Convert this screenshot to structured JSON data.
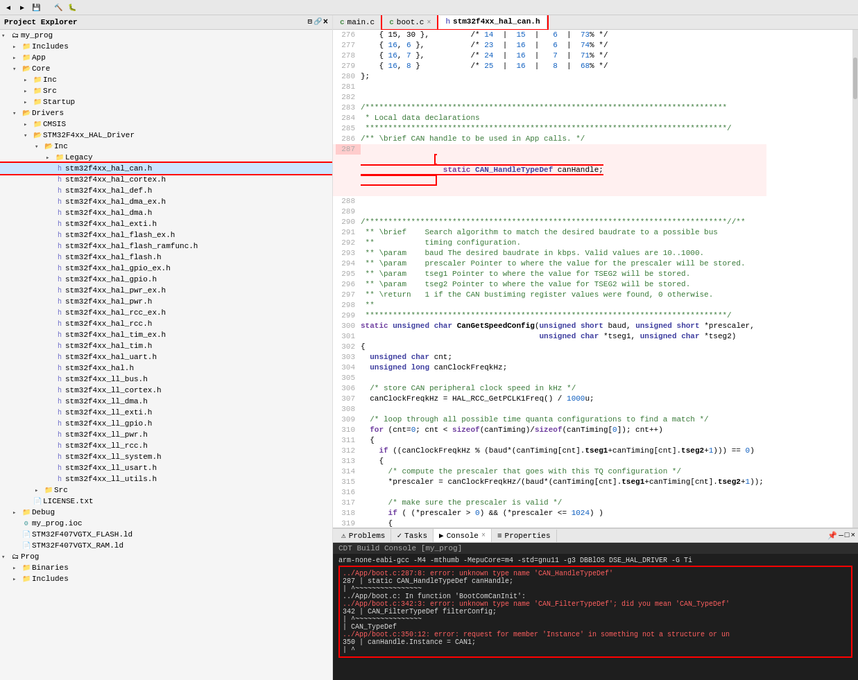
{
  "toolbar": {
    "title": "Project Explorer"
  },
  "sidebar": {
    "header": "Project Explorer",
    "close_icon": "×",
    "tree": [
      {
        "id": "my_prog",
        "label": "my_prog",
        "level": 0,
        "type": "project",
        "expanded": true,
        "arrow": "▾"
      },
      {
        "id": "includes_root",
        "label": "Includes",
        "level": 1,
        "type": "folder",
        "expanded": false,
        "arrow": "▸"
      },
      {
        "id": "app",
        "label": "App",
        "level": 1,
        "type": "folder",
        "expanded": false,
        "arrow": "▸"
      },
      {
        "id": "core",
        "label": "Core",
        "level": 1,
        "type": "folder",
        "expanded": true,
        "arrow": "▾"
      },
      {
        "id": "inc",
        "label": "Inc",
        "level": 2,
        "type": "folder",
        "expanded": false,
        "arrow": "▸"
      },
      {
        "id": "src",
        "label": "Src",
        "level": 2,
        "type": "folder",
        "expanded": false,
        "arrow": "▸"
      },
      {
        "id": "startup",
        "label": "Startup",
        "level": 2,
        "type": "folder",
        "expanded": false,
        "arrow": "▸"
      },
      {
        "id": "drivers",
        "label": "Drivers",
        "level": 1,
        "type": "folder",
        "expanded": true,
        "arrow": "▾"
      },
      {
        "id": "cmsis",
        "label": "CMSIS",
        "level": 2,
        "type": "folder",
        "expanded": false,
        "arrow": "▸"
      },
      {
        "id": "stm32f4xx_hal_driver",
        "label": "STM32F4xx_HAL_Driver",
        "level": 2,
        "type": "folder",
        "expanded": true,
        "arrow": "▾"
      },
      {
        "id": "inc2",
        "label": "Inc",
        "level": 3,
        "type": "folder",
        "expanded": true,
        "arrow": "▾"
      },
      {
        "id": "legacy",
        "label": "Legacy",
        "level": 4,
        "type": "folder",
        "expanded": false,
        "arrow": "▸"
      },
      {
        "id": "stm32f4xx_hal_can_h",
        "label": "stm32f4xx_hal_can.h",
        "level": 4,
        "type": "file_h",
        "expanded": false,
        "arrow": "",
        "selected": true,
        "highlighted": true
      },
      {
        "id": "stm32f4xx_hal_cortex_h",
        "label": "stm32f4xx_hal_cortex.h",
        "level": 4,
        "type": "file_h",
        "arrow": ""
      },
      {
        "id": "stm32f4xx_hal_def_h",
        "label": "stm32f4xx_hal_def.h",
        "level": 4,
        "type": "file_h",
        "arrow": ""
      },
      {
        "id": "stm32f4xx_hal_dma_ex_h",
        "label": "stm32f4xx_hal_dma_ex.h",
        "level": 4,
        "type": "file_h",
        "arrow": ""
      },
      {
        "id": "stm32f4xx_hal_dma_h",
        "label": "stm32f4xx_hal_dma.h",
        "level": 4,
        "type": "file_h",
        "arrow": ""
      },
      {
        "id": "stm32f4xx_hal_exti_h",
        "label": "stm32f4xx_hal_exti.h",
        "level": 4,
        "type": "file_h",
        "arrow": ""
      },
      {
        "id": "stm32f4xx_hal_flash_ex_h",
        "label": "stm32f4xx_hal_flash_ex.h",
        "level": 4,
        "type": "file_h",
        "arrow": ""
      },
      {
        "id": "stm32f4xx_hal_flash_ramfunc_h",
        "label": "stm32f4xx_hal_flash_ramfunc.h",
        "level": 4,
        "type": "file_h",
        "arrow": ""
      },
      {
        "id": "stm32f4xx_hal_flash_h",
        "label": "stm32f4xx_hal_flash.h",
        "level": 4,
        "type": "file_h",
        "arrow": ""
      },
      {
        "id": "stm32f4xx_hal_gpio_ex_h",
        "label": "stm32f4xx_hal_gpio_ex.h",
        "level": 4,
        "type": "file_h",
        "arrow": ""
      },
      {
        "id": "stm32f4xx_hal_gpio_h",
        "label": "stm32f4xx_hal_gpio.h",
        "level": 4,
        "type": "file_h",
        "arrow": ""
      },
      {
        "id": "stm32f4xx_hal_pwr_ex_h",
        "label": "stm32f4xx_hal_pwr_ex.h",
        "level": 4,
        "type": "file_h",
        "arrow": ""
      },
      {
        "id": "stm32f4xx_hal_pwr_h",
        "label": "stm32f4xx_hal_pwr.h",
        "level": 4,
        "type": "file_h",
        "arrow": ""
      },
      {
        "id": "stm32f4xx_hal_rcc_ex_h",
        "label": "stm32f4xx_hal_rcc_ex.h",
        "level": 4,
        "type": "file_h",
        "arrow": ""
      },
      {
        "id": "stm32f4xx_hal_rcc_h",
        "label": "stm32f4xx_hal_rcc.h",
        "level": 4,
        "type": "file_h",
        "arrow": ""
      },
      {
        "id": "stm32f4xx_hal_tim_ex_h",
        "label": "stm32f4xx_hal_tim_ex.h",
        "level": 4,
        "type": "file_h",
        "arrow": ""
      },
      {
        "id": "stm32f4xx_hal_tim_h",
        "label": "stm32f4xx_hal_tim.h",
        "level": 4,
        "type": "file_h",
        "arrow": ""
      },
      {
        "id": "stm32f4xx_hal_uart_h",
        "label": "stm32f4xx_hal_uart.h",
        "level": 4,
        "type": "file_h",
        "arrow": ""
      },
      {
        "id": "stm32f4xx_hal_h",
        "label": "stm32f4xx_hal.h",
        "level": 4,
        "type": "file_h",
        "arrow": ""
      },
      {
        "id": "stm32f4xx_ll_bus_h",
        "label": "stm32f4xx_ll_bus.h",
        "level": 4,
        "type": "file_h",
        "arrow": ""
      },
      {
        "id": "stm32f4xx_ll_cortex_h",
        "label": "stm32f4xx_ll_cortex.h",
        "level": 4,
        "type": "file_h",
        "arrow": ""
      },
      {
        "id": "stm32f4xx_ll_dma_h",
        "label": "stm32f4xx_ll_dma.h",
        "level": 4,
        "type": "file_h",
        "arrow": ""
      },
      {
        "id": "stm32f4xx_ll_exti_h",
        "label": "stm32f4xx_ll_exti.h",
        "level": 4,
        "type": "file_h",
        "arrow": ""
      },
      {
        "id": "stm32f4xx_ll_gpio_h",
        "label": "stm32f4xx_ll_gpio.h",
        "level": 4,
        "type": "file_h",
        "arrow": ""
      },
      {
        "id": "stm32f4xx_ll_pwr_h",
        "label": "stm32f4xx_ll_pwr.h",
        "level": 4,
        "type": "file_h",
        "arrow": ""
      },
      {
        "id": "stm32f4xx_ll_rcc_h",
        "label": "stm32f4xx_ll_rcc.h",
        "level": 4,
        "type": "file_h",
        "arrow": ""
      },
      {
        "id": "stm32f4xx_ll_system_h",
        "label": "stm32f4xx_ll_system.h",
        "level": 4,
        "type": "file_h",
        "arrow": ""
      },
      {
        "id": "stm32f4xx_ll_usart_h",
        "label": "stm32f4xx_ll_usart.h",
        "level": 4,
        "type": "file_h",
        "arrow": ""
      },
      {
        "id": "stm32f4xx_ll_utils_h",
        "label": "stm32f4xx_ll_utils.h",
        "level": 4,
        "type": "file_h",
        "arrow": ""
      },
      {
        "id": "src2",
        "label": "Src",
        "level": 3,
        "type": "folder",
        "expanded": false,
        "arrow": "▸"
      },
      {
        "id": "license",
        "label": "LICENSE.txt",
        "level": 2,
        "type": "file_txt",
        "arrow": ""
      },
      {
        "id": "debug",
        "label": "Debug",
        "level": 1,
        "type": "folder",
        "expanded": false,
        "arrow": "▸"
      },
      {
        "id": "my_prog_ioc",
        "label": "my_prog.ioc",
        "level": 1,
        "type": "file_ioc",
        "arrow": ""
      },
      {
        "id": "stm32f407vgtx_flash",
        "label": "STM32F407VGTX_FLASH.ld",
        "level": 1,
        "type": "file_ld",
        "arrow": ""
      },
      {
        "id": "stm32f407vgtx_ram",
        "label": "STM32F407VGTX_RAM.ld",
        "level": 1,
        "type": "file_ld",
        "arrow": ""
      },
      {
        "id": "prog",
        "label": "Prog",
        "level": 0,
        "type": "project",
        "expanded": true,
        "arrow": "▾"
      },
      {
        "id": "binaries",
        "label": "Binaries",
        "level": 1,
        "type": "folder",
        "expanded": false,
        "arrow": "▸"
      },
      {
        "id": "includes_prog",
        "label": "Includes",
        "level": 1,
        "type": "folder",
        "expanded": false,
        "arrow": "▸"
      }
    ]
  },
  "editor": {
    "tabs": [
      {
        "id": "main_c",
        "label": "main.c",
        "type": "c",
        "active": false,
        "closeable": false
      },
      {
        "id": "boot_c",
        "label": "boot.c",
        "type": "c",
        "active": false,
        "closeable": true
      },
      {
        "id": "stm32f4xx_hal_can_h",
        "label": "stm32f4xx_hal_can.h",
        "type": "h",
        "active": true,
        "closeable": false
      }
    ],
    "lines": [
      {
        "num": 276,
        "content": "    { 15, 30 },          /* 14  |  15  |   6  |  73% */",
        "type": "plain"
      },
      {
        "num": 277,
        "content": "    { 16, 6 },           /* 23  |  16  |   6  |  74% */",
        "type": "plain"
      },
      {
        "num": 278,
        "content": "    { 16, 7 },           /* 24  |  16  |   7  |  71% */",
        "type": "plain"
      },
      {
        "num": 279,
        "content": "    { 16, 8 }            /* 25  |  16  |   8  |  68% */",
        "type": "plain"
      },
      {
        "num": 280,
        "content": "};",
        "type": "plain"
      },
      {
        "num": 281,
        "content": "",
        "type": "plain"
      },
      {
        "num": 282,
        "content": "",
        "type": "plain"
      },
      {
        "num": 283,
        "content": "/*******************************************************************************",
        "type": "comment"
      },
      {
        "num": 284,
        "content": " * Local data declarations",
        "type": "comment"
      },
      {
        "num": 285,
        "content": " *******************************************************************************/",
        "type": "comment"
      },
      {
        "num": 286,
        "content": "/** \\brief CAN handle to be used in App calls. */",
        "type": "comment"
      },
      {
        "num": 287,
        "content": "static CAN_HandleTypeDef canHandle;",
        "type": "code_red_box"
      },
      {
        "num": 288,
        "content": "",
        "type": "plain"
      },
      {
        "num": 289,
        "content": "",
        "type": "plain"
      },
      {
        "num": 290,
        "content": "/*******************************************************************************//**",
        "type": "comment"
      },
      {
        "num": 291,
        "content": " ** \\brief    Search algorithm to match the desired baudrate to a possible bus",
        "type": "comment"
      },
      {
        "num": 292,
        "content": " **           timing configuration.",
        "type": "comment"
      },
      {
        "num": 293,
        "content": " ** \\param    baud The desired baudrate in kbps. Valid values are 10..1000.",
        "type": "comment"
      },
      {
        "num": 294,
        "content": " ** \\param    prescaler Pointer to where the value for the prescaler will be stored.",
        "type": "comment"
      },
      {
        "num": 295,
        "content": " ** \\param    tseg1 Pointer to where the value for TSEG2 will be stored.",
        "type": "comment"
      },
      {
        "num": 296,
        "content": " ** \\param    tseg2 Pointer to where the value for TSEG2 will be stored.",
        "type": "comment"
      },
      {
        "num": 297,
        "content": " ** \\return   1 if the CAN bustiming register values were found, 0 otherwise.",
        "type": "comment"
      },
      {
        "num": 298,
        "content": " **",
        "type": "comment"
      },
      {
        "num": 299,
        "content": " *******************************************************************************/",
        "type": "comment"
      },
      {
        "num": 300,
        "content": "static unsigned char CanGetSpeedConfig(unsigned short baud, unsigned short *prescaler,",
        "type": "code"
      },
      {
        "num": 301,
        "content": "                                       unsigned char *tseg1, unsigned char *tseg2)",
        "type": "code"
      },
      {
        "num": 302,
        "content": "{",
        "type": "plain"
      },
      {
        "num": 303,
        "content": "  unsigned char cnt;",
        "type": "code"
      },
      {
        "num": 304,
        "content": "  unsigned long canClockFreqkHz;",
        "type": "code"
      },
      {
        "num": 305,
        "content": "",
        "type": "plain"
      },
      {
        "num": 306,
        "content": "  /* store CAN peripheral clock speed in kHz */",
        "type": "comment"
      },
      {
        "num": 307,
        "content": "  canClockFreqkHz = HAL_RCC_GetPCLK1Freq() / 1000u;",
        "type": "code"
      },
      {
        "num": 308,
        "content": "",
        "type": "plain"
      },
      {
        "num": 309,
        "content": "  /* loop through all possible time quanta configurations to find a match */",
        "type": "comment"
      },
      {
        "num": 310,
        "content": "  for (cnt=0; cnt < sizeof(canTiming)/sizeof(canTiming[0]); cnt++)",
        "type": "code"
      },
      {
        "num": 311,
        "content": "  {",
        "type": "plain"
      },
      {
        "num": 312,
        "content": "    if ((canClockFreqkHz % (baud*(canTiming[cnt].tseg1+canTiming[cnt].tseg2+1))) == 0)",
        "type": "code"
      },
      {
        "num": 313,
        "content": "    {",
        "type": "plain"
      },
      {
        "num": 314,
        "content": "      /* compute the prescaler that goes with this TQ configuration */",
        "type": "comment"
      },
      {
        "num": 315,
        "content": "      *prescaler = canClockFreqkHz/(baud*(canTiming[cnt].tseg1+canTiming[cnt].tseg2+1));",
        "type": "code"
      },
      {
        "num": 316,
        "content": "",
        "type": "plain"
      },
      {
        "num": 317,
        "content": "      /* make sure the prescaler is valid */",
        "type": "comment"
      },
      {
        "num": 318,
        "content": "      if ( (*prescaler > 0) && (*prescaler <= 1024) )",
        "type": "code"
      },
      {
        "num": 319,
        "content": "      {",
        "type": "plain"
      }
    ]
  },
  "bottom_panel": {
    "tabs": [
      {
        "id": "problems",
        "label": "Problems",
        "icon": "⚠"
      },
      {
        "id": "tasks",
        "label": "Tasks",
        "icon": "✓"
      },
      {
        "id": "console",
        "label": "Console",
        "active": true,
        "icon": "▶"
      },
      {
        "id": "properties",
        "label": "Properties",
        "icon": "≡"
      }
    ],
    "console_title": "CDT Build Console [my_prog]",
    "error_lines": [
      {
        "text": "arm-none-eabi-gcc -M4 -mthumb -MepuCore=m4 -std=gnu11 -g3  DBBlOS  DSE_HAL_DRIVER  -G  Ti",
        "type": "plain"
      },
      {
        "text": "../App/boot.c:287:8: error: unknown type name 'CAN_HandleTypeDef'",
        "type": "error"
      },
      {
        "text": "  287 |  static CAN_HandleTypeDef canHandle;",
        "type": "plain"
      },
      {
        "text": "       |        ^~~~~~~~~~~~~~~~~",
        "type": "plain"
      },
      {
        "text": "../App/boot.c: In function 'BootComCanInit':",
        "type": "plain"
      },
      {
        "text": "../App/boot.c:342:3: error: unknown type name 'CAN_FilterTypeDef'; did you mean 'CAN_TypeDef'",
        "type": "error"
      },
      {
        "text": "  342 |    CAN_FilterTypeDef filterConfig;",
        "type": "plain"
      },
      {
        "text": "       |    ^~~~~~~~~~~~~~~~~",
        "type": "plain"
      },
      {
        "text": "       |    CAN_TypeDef",
        "type": "plain"
      },
      {
        "text": "../App/boot.c:350:12: error: request for member 'Instance' in something not a structure or un",
        "type": "error"
      },
      {
        "text": "  350 |    canHandle.Instance = CAN1;",
        "type": "plain"
      },
      {
        "text": "       |            ^",
        "type": "plain"
      }
    ]
  }
}
